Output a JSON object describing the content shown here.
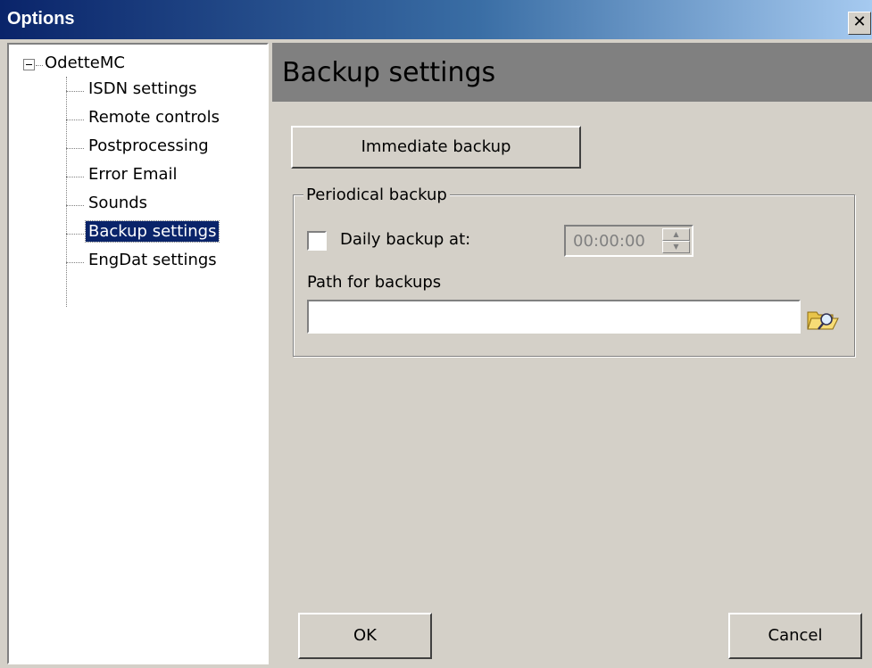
{
  "window": {
    "title": "Options",
    "close_glyph": "✕"
  },
  "tree": {
    "root": "OdetteMC",
    "items": [
      {
        "label": "ISDN settings",
        "selected": false
      },
      {
        "label": "Remote controls",
        "selected": false
      },
      {
        "label": "Postprocessing",
        "selected": false
      },
      {
        "label": "Error Email",
        "selected": false
      },
      {
        "label": "Sounds",
        "selected": false
      },
      {
        "label": "Backup settings",
        "selected": true
      },
      {
        "label": "EngDat settings",
        "selected": false
      }
    ]
  },
  "panel": {
    "title": "Backup settings",
    "immediate_button": "Immediate backup",
    "group_title": "Periodical backup",
    "daily_checkbox_label": "Daily backup at:",
    "daily_checked": false,
    "time_value": "00:00:00",
    "path_label": "Path for backups",
    "path_value": "",
    "browse_icon": "folder-browse-icon"
  },
  "footer": {
    "ok": "OK",
    "cancel": "Cancel"
  }
}
